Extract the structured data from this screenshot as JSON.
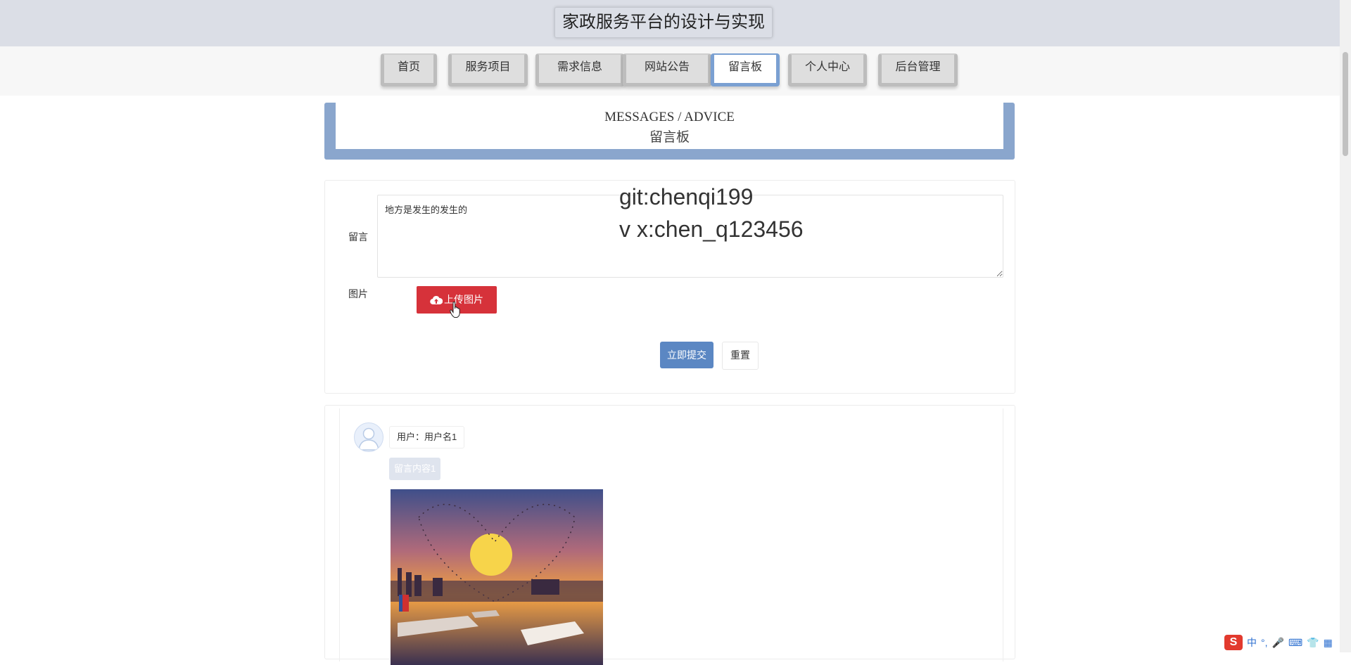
{
  "site": {
    "title": "家政服务平台的设计与实现"
  },
  "nav": {
    "items": [
      {
        "label": "首页"
      },
      {
        "label": "服务项目"
      },
      {
        "label": "需求信息"
      },
      {
        "label": "网站公告"
      },
      {
        "label": "留言板"
      },
      {
        "label": "个人中心"
      },
      {
        "label": "后台管理"
      }
    ],
    "active": "留言板"
  },
  "banner": {
    "en": "MESSAGES / ADVICE",
    "zh": "留言板"
  },
  "form": {
    "message_label": "留言",
    "message_value": "地方是发生的发生的",
    "image_label": "图片",
    "upload_label": "上传图片",
    "submit_label": "立即提交",
    "reset_label": "重置"
  },
  "watermark": {
    "line1": "git:chenqi199",
    "line2": "v x:chen_q123456"
  },
  "messages": [
    {
      "user": "用户：用户名1",
      "content": "留言内容1",
      "image": "sunset-river-photo"
    }
  ],
  "ime": {
    "mode": "中",
    "punct": "°,"
  },
  "colors": {
    "accent": "#5b87c3",
    "upload": "#d6323a",
    "banner": "#8aa6cd",
    "header": "#dbdee6"
  }
}
